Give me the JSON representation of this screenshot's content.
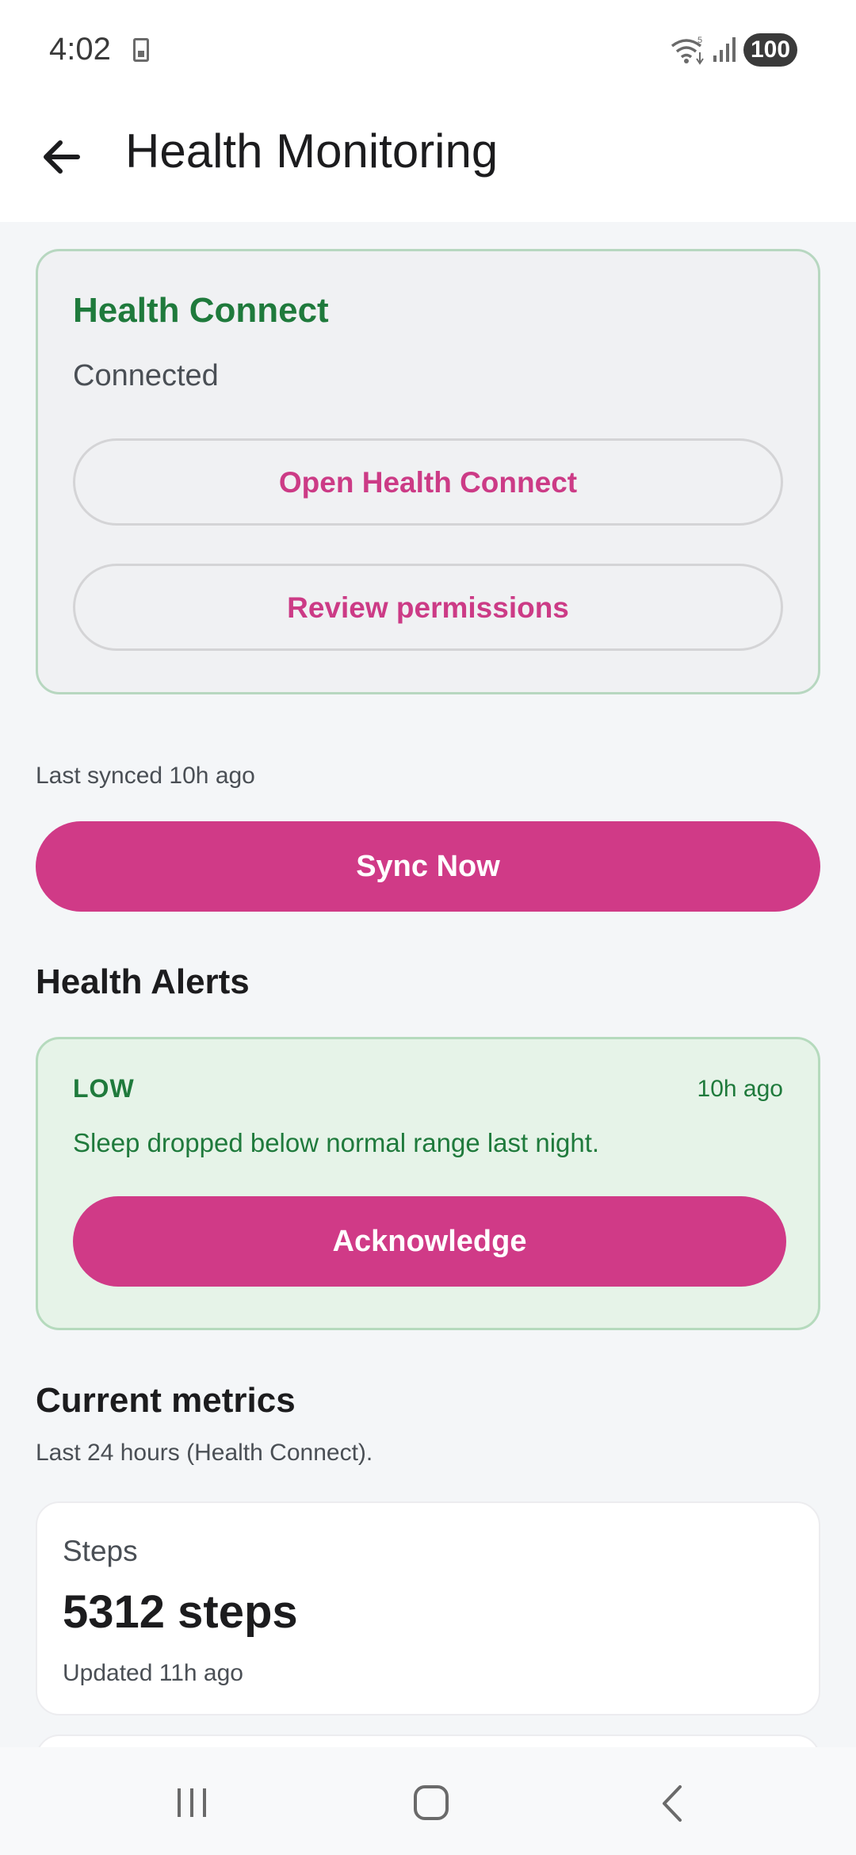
{
  "status_bar": {
    "time": "4:02",
    "battery": "100"
  },
  "app_bar": {
    "title": "Health Monitoring",
    "back_icon": "arrow-back-icon"
  },
  "health_connect": {
    "title": "Health Connect",
    "status": "Connected",
    "open_button": "Open Health Connect",
    "review_button": "Review permissions"
  },
  "sync": {
    "last_synced": "Last synced 10h ago",
    "button": "Sync Now"
  },
  "alerts": {
    "title": "Health Alerts",
    "items": [
      {
        "level": "LOW",
        "time": "10h ago",
        "message": "Sleep dropped below normal range last night.",
        "action": "Acknowledge"
      }
    ]
  },
  "metrics": {
    "title": "Current metrics",
    "subtitle": "Last 24 hours (Health Connect).",
    "items": [
      {
        "name": "Steps",
        "value": "5312 steps",
        "updated": "Updated 11h ago"
      }
    ]
  },
  "nav_bar": {
    "icons": [
      "recents-icon",
      "home-icon",
      "back-icon"
    ]
  },
  "colors": {
    "accent": "#d03a87",
    "connected_green": "#1f7a3c",
    "alert_bg": "#e6f3e8",
    "background": "#f4f6f8"
  }
}
